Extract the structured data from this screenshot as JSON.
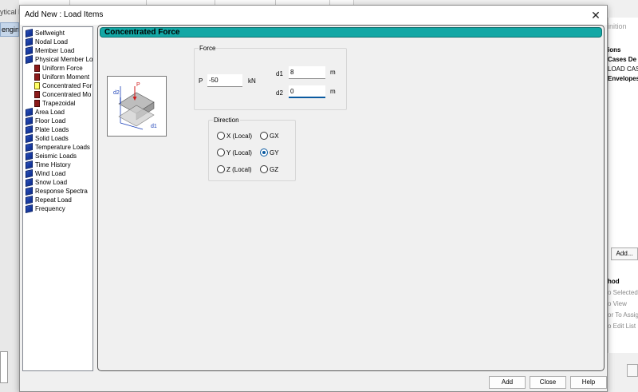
{
  "background": {
    "left_title": "ytical M",
    "left_tab": "engin",
    "right_title": "inition",
    "right_items": [
      {
        "text": "ions",
        "bold": true
      },
      {
        "text": "Cases De",
        "bold": true
      },
      {
        "text": "LOAD CAS",
        "bold": false
      },
      {
        "text": "Envelopes",
        "bold": true
      }
    ],
    "add_button": "Add...",
    "method_label": "hod",
    "method_items": [
      "o Selected",
      "o View",
      "or To Assig",
      "o Edit List"
    ]
  },
  "dialog": {
    "title": "Add New : Load Items",
    "close_glyph": "✕"
  },
  "tree": {
    "items": [
      {
        "label": "Selfweight",
        "icon": "book-icon",
        "level": 0
      },
      {
        "label": "Nodal Load",
        "icon": "book-icon",
        "level": 0
      },
      {
        "label": "Member Load",
        "icon": "book-icon",
        "level": 0
      },
      {
        "label": "Physical Member Lo",
        "icon": "book-icon",
        "level": 0
      },
      {
        "label": "Uniform Force",
        "icon": "leaf-icon",
        "level": 1
      },
      {
        "label": "Uniform Moment",
        "icon": "leaf-icon",
        "level": 1
      },
      {
        "label": "Concentrated For",
        "icon": "leaf-selected-icon",
        "level": 1
      },
      {
        "label": "Concentrated Mo",
        "icon": "leaf-icon",
        "level": 1
      },
      {
        "label": "Trapezoidal",
        "icon": "leaf-icon",
        "level": 1
      },
      {
        "label": "Area Load",
        "icon": "book-icon",
        "level": 0
      },
      {
        "label": "Floor Load",
        "icon": "book-icon",
        "level": 0
      },
      {
        "label": "Plate Loads",
        "icon": "book-icon",
        "level": 0
      },
      {
        "label": "Solid Loads",
        "icon": "book-icon",
        "level": 0
      },
      {
        "label": "Temperature Loads",
        "icon": "book-icon",
        "level": 0
      },
      {
        "label": "Seismic Loads",
        "icon": "book-icon",
        "level": 0
      },
      {
        "label": "Time History",
        "icon": "book-icon",
        "level": 0
      },
      {
        "label": "Wind Load",
        "icon": "book-icon",
        "level": 0
      },
      {
        "label": "Snow Load",
        "icon": "book-icon",
        "level": 0
      },
      {
        "label": "Response Spectra",
        "icon": "book-icon",
        "level": 0
      },
      {
        "label": "Repeat Load",
        "icon": "book-icon",
        "level": 0
      },
      {
        "label": "Frequency",
        "icon": "book-icon",
        "level": 0
      }
    ]
  },
  "panel": {
    "title": "Concentrated Force",
    "diagram": {
      "label_p": "P",
      "label_d1": "d1",
      "label_d2": "d2"
    },
    "force": {
      "legend": "Force",
      "p_label": "P",
      "p_value": "-50",
      "p_unit": "kN",
      "d1_label": "d1",
      "d1_value": "8",
      "d1_unit": "m",
      "d2_label": "d2",
      "d2_value": "0",
      "d2_unit": "m"
    },
    "direction": {
      "legend": "Direction",
      "options": [
        {
          "label": "X (Local)",
          "selected": false
        },
        {
          "label": "GX",
          "selected": false
        },
        {
          "label": "Y (Local)",
          "selected": false
        },
        {
          "label": "GY",
          "selected": true
        },
        {
          "label": "Z (Local)",
          "selected": false
        },
        {
          "label": "GZ",
          "selected": false
        }
      ]
    }
  },
  "buttons": {
    "add": "Add",
    "close": "Close",
    "help": "Help"
  },
  "colors": {
    "header_teal": "#13a7a5",
    "accent_blue": "#0a5aa0",
    "book_blue": "#0a2a8c",
    "leaf_red": "#8b1a1a",
    "leaf_selected": "#ffff66"
  }
}
